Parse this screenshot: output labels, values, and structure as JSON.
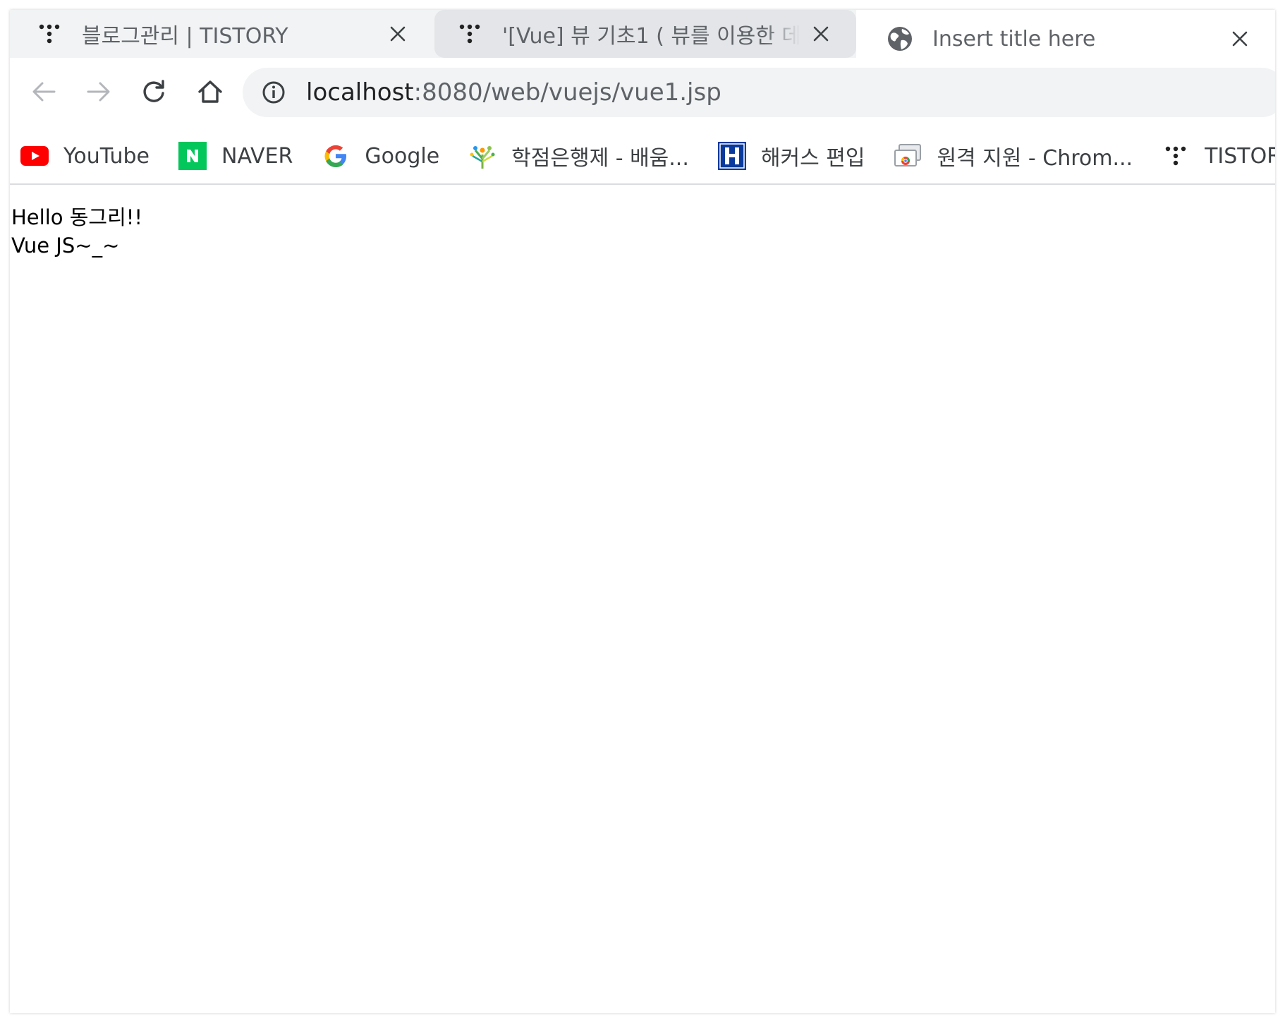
{
  "tabs": [
    {
      "title": "블로그관리 | TISTORY",
      "favicon": "tistory-icon"
    },
    {
      "title": "'[Vue] 뷰 기초1 ( 뷰를 이용한 데",
      "favicon": "tistory-icon"
    },
    {
      "title": "Insert title here",
      "favicon": "globe-icon"
    }
  ],
  "toolbar": {
    "url_host": "localhost",
    "url_rest": ":8080/web/vuejs/vue1.jsp"
  },
  "bookmarks": [
    {
      "label": "YouTube",
      "icon": "youtube-icon"
    },
    {
      "label": "NAVER",
      "icon": "naver-icon"
    },
    {
      "label": "Google",
      "icon": "google-icon"
    },
    {
      "label": "학점은행제 - 배움...",
      "icon": "hakjeom-icon"
    },
    {
      "label": "해커스 편입",
      "icon": "hackers-icon"
    },
    {
      "label": "원격 지원 - Chrom...",
      "icon": "remote-desktop-icon"
    },
    {
      "label": "TISTORY",
      "icon": "tistory-icon"
    }
  ],
  "content": {
    "line1": "Hello 동그리!!",
    "line2": "Vue JS~_~"
  },
  "colors": {
    "tabstrip_bg": "#f1f3f4",
    "active_tab_bg": "#ffffff",
    "omnibox_bg": "#f1f3f4",
    "youtube_red": "#ff0000",
    "naver_green": "#03c75a",
    "hackers_blue": "#0a3a9c"
  }
}
